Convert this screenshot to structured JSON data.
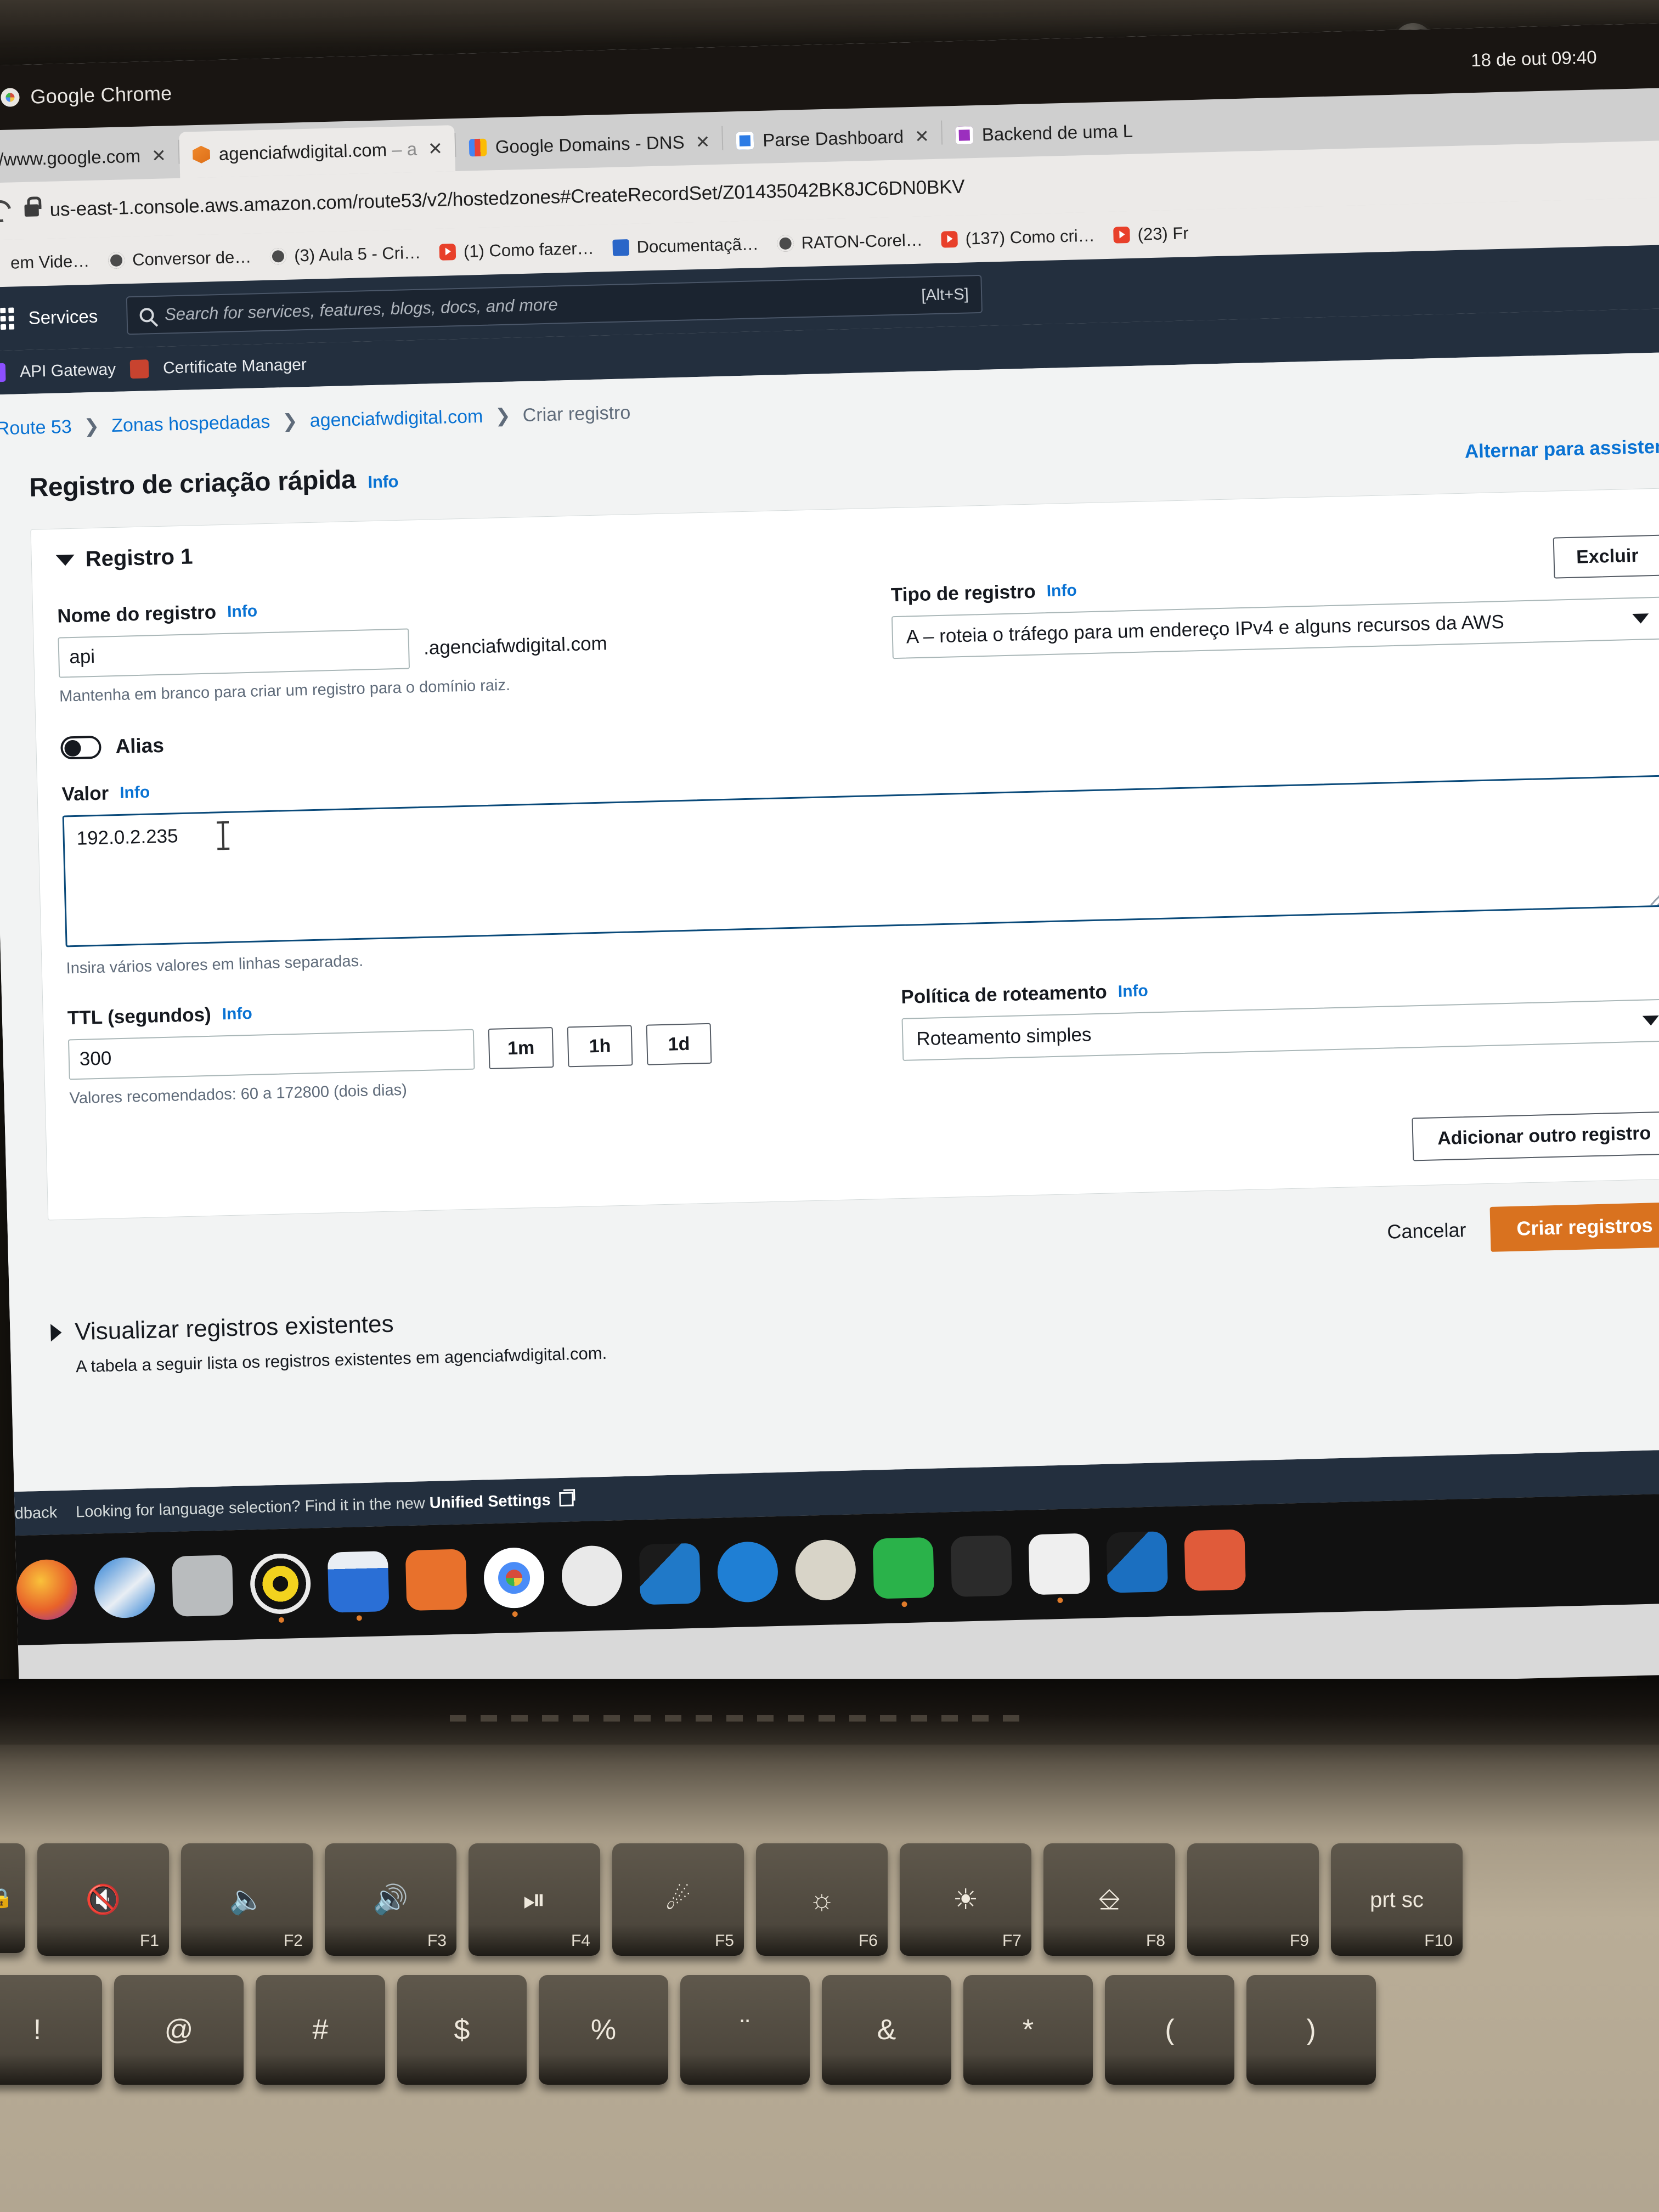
{
  "os": {
    "app_menu_title": "Google Chrome",
    "clock": "18 de out  09:40"
  },
  "browser": {
    "tabs": [
      {
        "title": "//www.google.com",
        "favicon": "none",
        "active": false,
        "close": "✕"
      },
      {
        "title": "agenciafwdigital.com",
        "title_dim": " – a",
        "favicon": "aws-icon",
        "active": true,
        "close": "✕"
      },
      {
        "title": "Google Domains - DNS",
        "favicon": "google-domains-icon",
        "active": false,
        "close": "✕"
      },
      {
        "title": "Parse Dashboard",
        "favicon": "parse-icon",
        "active": false,
        "close": "✕"
      },
      {
        "title": "Backend de uma L",
        "favicon": "backend-icon",
        "active": false,
        "close": ""
      }
    ],
    "url": "us-east-1.console.aws.amazon.com/route53/v2/hostedzones#CreateRecordSet/Z01435042BK8JC6DN0BKV",
    "bookmarks": [
      {
        "label": "em Vide…",
        "icon": "none"
      },
      {
        "label": "Conversor de…",
        "icon": "globe-icon"
      },
      {
        "label": "(3) Aula 5 - Cri…",
        "icon": "globe-icon"
      },
      {
        "label": "(1) Como fazer…",
        "icon": "youtube-icon"
      },
      {
        "label": "Documentaçã…",
        "icon": "doc-icon"
      },
      {
        "label": "RATON-Corel…",
        "icon": "globe-icon"
      },
      {
        "label": "(137) Como cri…",
        "icon": "youtube-icon"
      },
      {
        "label": "(23) Fr",
        "icon": "youtube-icon"
      }
    ]
  },
  "aws_nav": {
    "services_label": "Services",
    "search_placeholder": "Search for services, features, blogs, docs, and more",
    "search_shortcut": "[Alt+S]",
    "favorites": [
      {
        "label": "API Gateway",
        "icon": "api-gateway-icon"
      },
      {
        "label": "Certificate Manager",
        "icon": "certificate-manager-icon"
      }
    ]
  },
  "breadcrumb": [
    {
      "label": "Route 53",
      "current": false
    },
    {
      "label": "Zonas hospedadas",
      "current": false
    },
    {
      "label": "agenciafwdigital.com",
      "current": false
    },
    {
      "label": "Criar registro",
      "current": true
    }
  ],
  "page": {
    "title": "Registro de criação rápida",
    "title_info": "Info",
    "switch_link": "Alternar para assistente"
  },
  "record": {
    "section_title": "Registro 1",
    "delete_button": "Excluir",
    "name": {
      "label": "Nome do registro",
      "info": "Info",
      "value": "api",
      "suffix": ".agenciafwdigital.com",
      "hint": "Mantenha em branco para criar um registro para o domínio raiz."
    },
    "type": {
      "label": "Tipo de registro",
      "info": "Info",
      "value": "A – roteia o tráfego para um endereço IPv4 e alguns recursos da AWS"
    },
    "alias": {
      "label": "Alias",
      "enabled": false
    },
    "value": {
      "label": "Valor",
      "info": "Info",
      "text": "192.0.2.235",
      "hint": "Insira vários valores em linhas separadas."
    },
    "ttl": {
      "label": "TTL (segundos)",
      "info": "Info",
      "value": "300",
      "presets": [
        "1m",
        "1h",
        "1d"
      ],
      "hint": "Valores recomendados: 60 a 172800 (dois dias)"
    },
    "routing_policy": {
      "label": "Política de roteamento",
      "info": "Info",
      "value": "Roteamento simples"
    },
    "add_another": "Adicionar outro registro"
  },
  "actions": {
    "cancel": "Cancelar",
    "submit": "Criar registros"
  },
  "existing": {
    "title": "Visualizar registros existentes",
    "description": "A tabela a seguir lista os registros existentes em agenciafwdigital.com."
  },
  "footer": {
    "feedback": "dback",
    "notice": "Looking for language selection? Find it in the new",
    "notice_strong": "Unified Settings"
  },
  "dock": [
    {
      "name": "firefox-icon",
      "color": "#e8622a"
    },
    {
      "name": "thunderbird-icon",
      "color": "#2b7fd4"
    },
    {
      "name": "files-icon",
      "color": "#b9bcbe"
    },
    {
      "name": "rhythmbox-icon",
      "color": "#f2d21e"
    },
    {
      "name": "libreoffice-writer-icon",
      "color": "#2a6fd6"
    },
    {
      "name": "appstore-icon",
      "color": "#e8712c"
    },
    {
      "name": "chrome-icon",
      "color": "#4a8cf7"
    },
    {
      "name": "inkscape-icon",
      "color": "#e9e9e9"
    },
    {
      "name": "vscode-icon",
      "color": "#2079c8"
    },
    {
      "name": "help-icon",
      "color": "#1f7fd4"
    },
    {
      "name": "gimp-icon",
      "color": "#d8d4c8"
    },
    {
      "name": "whatsapp-icon",
      "color": "#2ab24a"
    },
    {
      "name": "terminal-icon",
      "color": "#2b2b2b"
    },
    {
      "name": "text-editor-icon",
      "color": "#efefef"
    },
    {
      "name": "vscode-insiders-icon",
      "color": "#1b6fc0"
    },
    {
      "name": "figma-icon",
      "color": "#e05b3a"
    }
  ],
  "keyboard": {
    "function_row": [
      {
        "glyph": "🔇",
        "label": "F1"
      },
      {
        "glyph": "🔈",
        "label": "F2"
      },
      {
        "glyph": "🔊",
        "label": "F3"
      },
      {
        "glyph": "⏯",
        "label": "F4"
      },
      {
        "glyph": "☀",
        "label": "F5"
      },
      {
        "glyph": "☼",
        "label": "F6"
      },
      {
        "glyph": "☀",
        "label": "F7"
      },
      {
        "glyph": "❐",
        "label": "F8"
      },
      {
        "glyph": "",
        "label": "F9"
      },
      {
        "glyph": "prt sc",
        "label": "F10"
      }
    ],
    "number_row": [
      "!",
      "@",
      "#",
      "$",
      "%",
      "¨",
      "&",
      "*",
      "(",
      ")"
    ]
  }
}
